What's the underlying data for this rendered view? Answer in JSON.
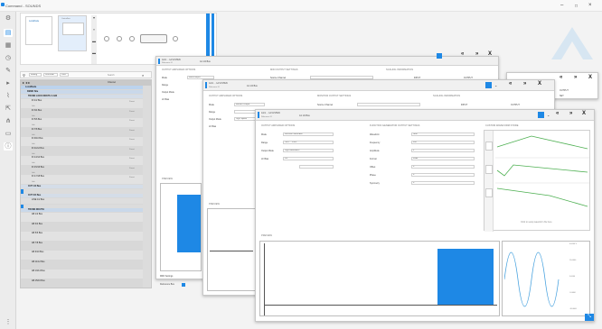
{
  "app": {
    "title": "Command - SOUNDS",
    "min": "–",
    "max": "□",
    "close": "×"
  },
  "topstrip": {
    "box1": "Localhode",
    "tab1": "Controllers"
  },
  "toolbar": {
    "search_label": "Search",
    "analog": "Analog",
    "controller": "Controller",
    "usb": "USB",
    "channel_header": "Channel"
  },
  "tree": {
    "root": "LocalNode",
    "group1": "DEMO Site",
    "group2": "TRUNK LOCK MOUTH 4.ANI",
    "items_a": [
      "IN 1/2 Bus",
      "IN 3/4 Bus",
      "IN 5/6 Bus",
      "IN 7/8 Bus",
      "IN 9/10 Bus",
      "IN 11/12 Bus",
      "IN 13/14 Bus",
      "IN 15/16 Bus",
      "IN 17/18 Bus"
    ],
    "sub_a": "Link",
    "group3": "OUT 1/2 Bus",
    "group4": "OUT 3/4 Bus",
    "item_mid": "LINE 1/2 Bus",
    "group5": "TRUNK MOUTH",
    "items_b": [
      "AB 1/2 Bus",
      "AB 3/4 Bus",
      "AB 5/6 Bus",
      "AB 7/8 Bus",
      "AB 9/10 Bus",
      "AB 11/12 Bus",
      "AB 13/14 Bus",
      "AB 15/16 Bus"
    ],
    "right_tag": "Preset"
  },
  "panel1": {
    "title": "A1/1 ... 1/2 LISTEN",
    "sub": "Reference IO",
    "tab": "A1 1/2 Bus",
    "s1": "OUTPUT AMPLIFIER OPTIONS",
    "s2": "MIDI OUTPUT SETTINGS",
    "s3": "SCALING INFORMATION",
    "l_mode": "Mode",
    "v_mode": "Multi-Output",
    "l_range": "Range",
    "l_outmode": "Output Mode",
    "l_level": "LF Bias",
    "l_source": "Source Channel",
    "l_input": "INPUT",
    "l_output": "OUTPUT",
    "preview": "PREVIEW",
    "foot1": "MIDI Settings",
    "foot2": "Reference Bus"
  },
  "panel2": {
    "title": "A1/1 ... 1/2 LISTEN",
    "sub": "Reference IO",
    "tab": "A1 1/2 Bus",
    "s1": "OUTPUT AMPLIFIER OPTIONS",
    "s2": "MONITOR OUTPUT SETTINGS",
    "s3": "SCALING INFORMATION",
    "l_mode": "Mode",
    "v_mode": "Monitor Output",
    "l_range": "Range",
    "l_outmode": "Output Mode",
    "v_outmode": "High Speed",
    "l_level": "LF Bias",
    "l_source": "Source Channel",
    "l_input": "INPUT",
    "l_output": "OUTPUT",
    "preview": "PREVIEW"
  },
  "panel3": {
    "title": "A1/1 ... 1/2 LISTEN",
    "sub": "Reference IO",
    "tab": "A1 1/2 Bus",
    "s1": "OUTPUT AMPLIFIER OPTIONS",
    "s2": "FUNCTION GENERATOR OUTPUT SETTINGS",
    "s3": "CUSTOM WAVEFORM STORE",
    "l_mode": "Mode",
    "v_mode": "Function Generator",
    "l_range": "Range",
    "v_range": "-10V ... +10V",
    "l_outmode": "Output Mode",
    "v_outmode": "High Resolution",
    "l_level": "LF Bias",
    "v_level": "Off",
    "f_wave": "Waveform",
    "v_wave": "Sine",
    "f_freq": "Frequency",
    "v_freq": "100",
    "f_amp": "Amplitude",
    "v_amp": "1",
    "f_fmt": "Format",
    "v_fmt": "Peak",
    "f_off": "Offset",
    "v_off": "0",
    "f_phase": "Phase",
    "v_phase": "0",
    "f_sym": "Symmetry",
    "v_sym": "0",
    "custom_hint": "Click to setup waveform file here",
    "preview": "PREVIEW",
    "scope_right": [
      "0.0000 V",
      "10.0000",
      "5.0000",
      "-5.0000",
      "-10.0000"
    ]
  },
  "panel4": {
    "nav1": "«",
    "nav2": "»",
    "close": "X",
    "tag1": "OUTPUT",
    "tag2": "SET"
  }
}
